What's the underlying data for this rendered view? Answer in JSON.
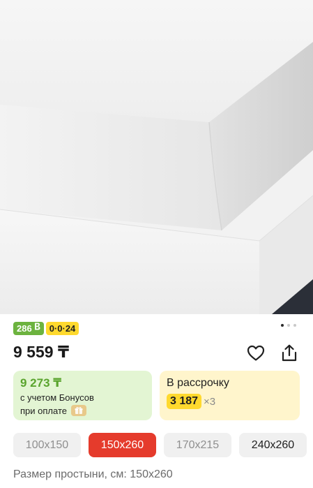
{
  "product_image": {
    "subject": "white-fitted-sheet"
  },
  "carousel": {
    "total": 3,
    "active": 0
  },
  "badges": {
    "bonus": {
      "text": "286",
      "icon": "bonus-b-icon",
      "color": "#6cb33f"
    },
    "installment": {
      "text": "0·0·24",
      "color": "#ffd92e"
    }
  },
  "price": {
    "text": "9 559 ₸"
  },
  "actions": {
    "favorite_icon": "heart-icon",
    "share_icon": "share-icon"
  },
  "bonus_card": {
    "price": "9 273 ₸",
    "line1": "с учетом Бонусов",
    "line2": "при оплате",
    "chip_icon": "gift-icon"
  },
  "installment_card": {
    "title": "В рассрочку",
    "amount": "3 187",
    "multiplier": "×3"
  },
  "sizes": {
    "options": [
      {
        "label": "100x150",
        "state": "unavailable"
      },
      {
        "label": "150x260",
        "state": "selected"
      },
      {
        "label": "170x215",
        "state": "unavailable"
      },
      {
        "label": "240x260",
        "state": "available"
      }
    ],
    "caption": "Размер простыни, см: 150x260"
  },
  "colors": {
    "accent_red": "#e53b2c",
    "bonus_green": "#5aa42e",
    "installment_yellow": "#ffd92e"
  }
}
